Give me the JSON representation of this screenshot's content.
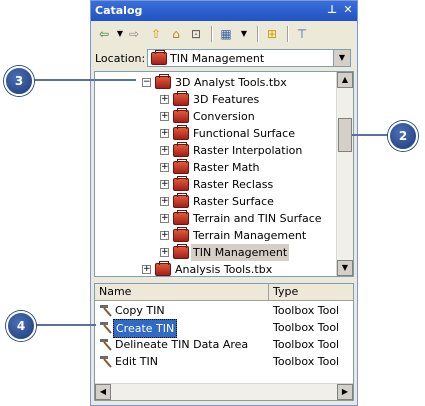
{
  "window": {
    "title": "Catalog",
    "pin_glyph": "⊥",
    "close_glyph": "✕"
  },
  "toolbar": {
    "icons": [
      "back-arrow-icon",
      "dropdown-arrow-icon",
      "forward-arrow-icon",
      "up-folder-icon",
      "home-icon",
      "disconnect-icon",
      "view-options-icon",
      "connect-folder-icon",
      "tree-view-icon"
    ]
  },
  "location": {
    "label": "Location:",
    "value": "TIN Management"
  },
  "tree": {
    "items": [
      {
        "label": "3D Analyst Tools.tbx",
        "expander": "−"
      },
      {
        "label": "3D Features",
        "expander": "+"
      },
      {
        "label": "Conversion",
        "expander": "+"
      },
      {
        "label": "Functional Surface",
        "expander": "+"
      },
      {
        "label": "Raster Interpolation",
        "expander": "+"
      },
      {
        "label": "Raster Math",
        "expander": "+"
      },
      {
        "label": "Raster Reclass",
        "expander": "+"
      },
      {
        "label": "Raster Surface",
        "expander": "+"
      },
      {
        "label": "Terrain and TIN Surface",
        "expander": "+"
      },
      {
        "label": "Terrain Management",
        "expander": "+"
      },
      {
        "label": "TIN Management",
        "expander": "+"
      },
      {
        "label": "Analysis Tools.tbx",
        "expander": "+"
      }
    ]
  },
  "list": {
    "columns": [
      "Name",
      "Type"
    ],
    "rows": [
      {
        "name": "Copy TIN",
        "type": "Toolbox Tool"
      },
      {
        "name": "Create TIN",
        "type": "Toolbox Tool"
      },
      {
        "name": "Delineate TIN Data Area",
        "type": "Toolbox Tool"
      },
      {
        "name": "Edit TIN",
        "type": "Toolbox Tool"
      }
    ]
  },
  "callouts": [
    "3",
    "2",
    "4"
  ],
  "colors": {
    "accent": "#316ac5",
    "callout": "#1d3a7a",
    "toolbox_red": "#c0392b"
  }
}
